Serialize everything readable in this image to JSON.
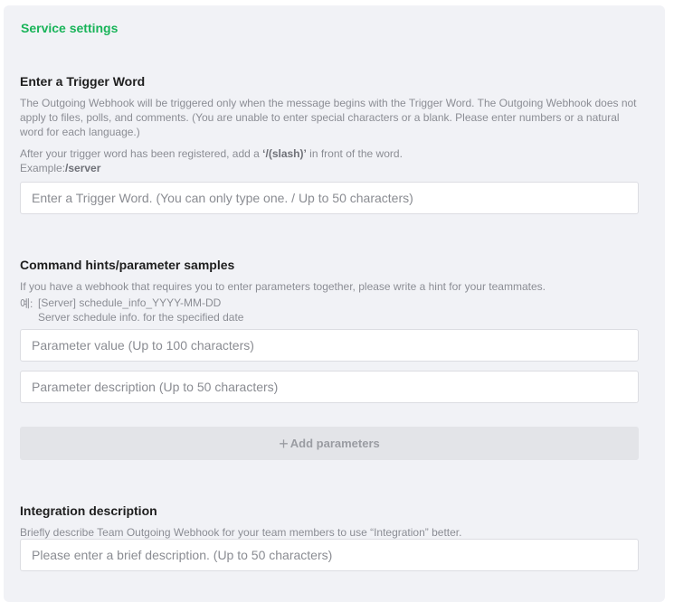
{
  "section_title": "Service settings",
  "trigger": {
    "heading": "Enter a Trigger Word",
    "desc1": "The Outgoing Webhook will be triggered only when the message begins with the Trigger Word. The Outgoing Webhook does not apply to files, polls, and comments. (You are unable to enter special characters or a blank. Please enter numbers or a natural word for each language.)",
    "desc2_prefix": "After your trigger word has been registered, add a ",
    "desc2_bold": "‘/(slash)’",
    "desc2_suffix": " in front of the word.",
    "example_prefix": "Example:",
    "example_bold": "/server",
    "placeholder": "Enter a Trigger Word. (You can only type one. / Up to 50 characters)"
  },
  "command": {
    "heading": "Command hints/parameter samples",
    "desc": "If you have a webhook that requires you to enter parameters together, please write a hint for your teammates.",
    "example_label": "예:",
    "example_line1": "[Server] schedule_info_YYYY-MM-DD",
    "example_line2": "Server schedule info. for the specified date",
    "param_value_placeholder": "Parameter value (Up to 100 characters)",
    "param_desc_placeholder": "Parameter description (Up to 50 characters)",
    "add_label": "Add parameters"
  },
  "integration": {
    "heading": "Integration description",
    "desc": "Briefly describe Team Outgoing Webhook for your team members to use “Integration” better.",
    "placeholder": "Please enter a brief description. (Up to 50 characters)"
  },
  "colors": {
    "accent": "#19b459",
    "panel_bg": "#f1f2f6"
  }
}
